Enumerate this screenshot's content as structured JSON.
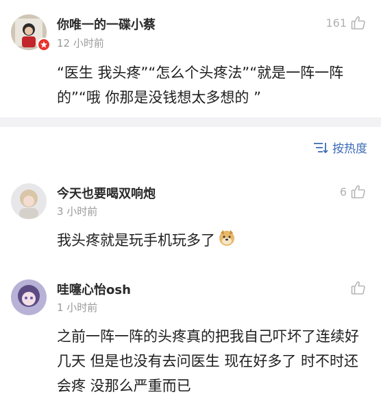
{
  "comments": [
    {
      "username": "你唯一的一碟小蔡",
      "time": "12 小时前",
      "likes": "161",
      "text": "“医生 我头疼”“怎么个头疼法”“就是一阵一阵的”“哦 你那是没钱想太多想的 ”"
    },
    {
      "username": "今天也要喝双响炮",
      "time": "3 小时前",
      "likes": "6",
      "text": "我头疼就是玩手机玩多了"
    },
    {
      "username": "哇噻心怡osh",
      "time": "1 小时前",
      "likes": "",
      "text": "之前一阵一阵的头疼真的把我自己吓坏了连续好几天 但是也没有去问医生 现在好多了  时不时还会疼 没那么严重而已"
    }
  ],
  "sort": {
    "label": "按热度"
  },
  "colors": {
    "accent": "#3d6bb5",
    "verified_badge": "#e8322c",
    "muted": "#9a9a9a"
  }
}
